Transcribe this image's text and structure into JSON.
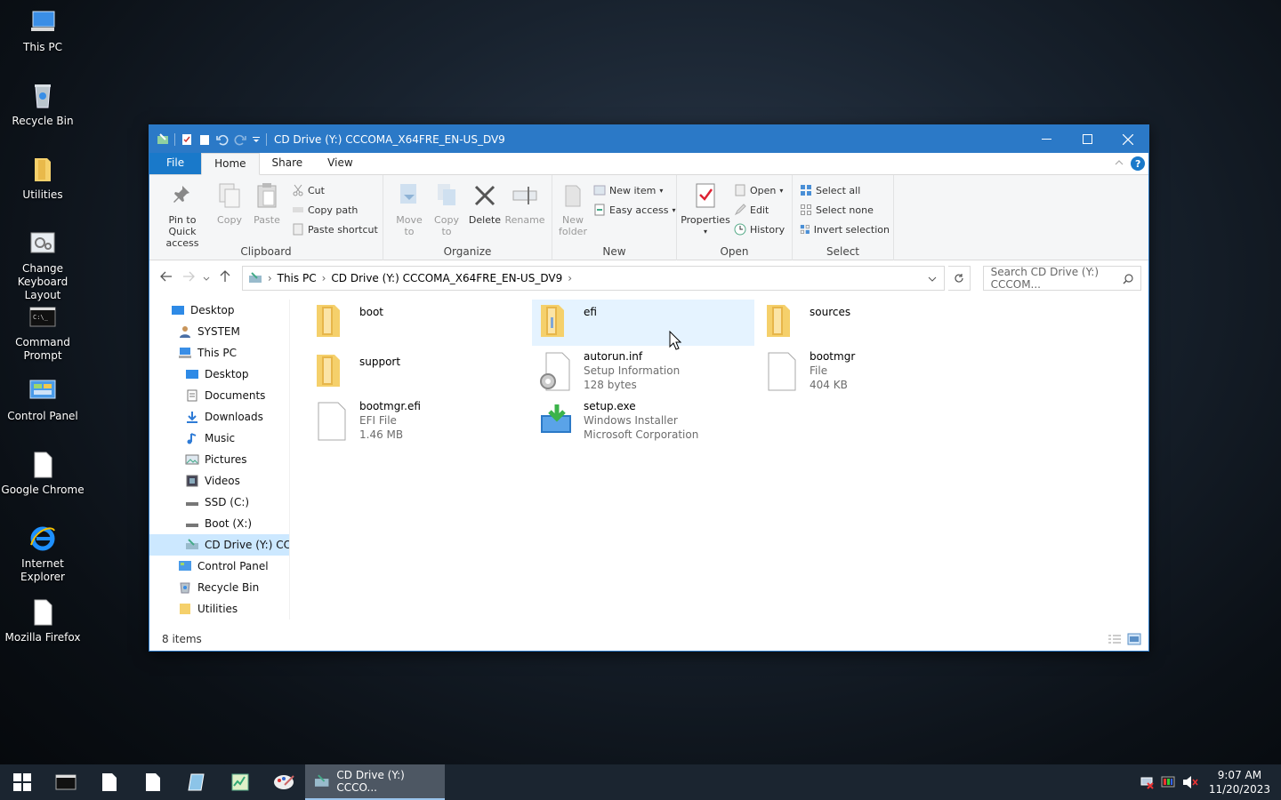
{
  "desktop": {
    "icons": [
      {
        "label": "This PC",
        "icon": "computer-icon"
      },
      {
        "label": "Recycle Bin",
        "icon": "recycle-bin-icon"
      },
      {
        "label": "Utilities",
        "icon": "folder-icon"
      },
      {
        "label": "Change Keyboard Layout",
        "icon": "settings-icon"
      },
      {
        "label": "Command Prompt",
        "icon": "cmd-icon"
      },
      {
        "label": "Control Panel",
        "icon": "control-panel-icon"
      },
      {
        "label": "Google Chrome",
        "icon": "file-icon"
      },
      {
        "label": "Internet Explorer",
        "icon": "ie-icon"
      },
      {
        "label": "Mozilla Firefox",
        "icon": "file-icon"
      }
    ]
  },
  "window": {
    "title": "CD Drive (Y:) CCCOMA_X64FRE_EN-US_DV9"
  },
  "ribbon": {
    "tabs": {
      "file": "File",
      "home": "Home",
      "share": "Share",
      "view": "View"
    },
    "clipboard": {
      "pin": "Pin to Quick access",
      "copy": "Copy",
      "paste": "Paste",
      "cut": "Cut",
      "copy_path": "Copy path",
      "paste_shortcut": "Paste shortcut",
      "label": "Clipboard"
    },
    "organize": {
      "move_to": "Move to",
      "copy_to": "Copy to",
      "delete": "Delete",
      "rename": "Rename",
      "label": "Organize"
    },
    "new": {
      "new_folder": "New folder",
      "new_item": "New item",
      "easy_access": "Easy access",
      "label": "New"
    },
    "open": {
      "properties": "Properties",
      "open": "Open",
      "edit": "Edit",
      "history": "History",
      "label": "Open"
    },
    "select": {
      "select_all": "Select all",
      "select_none": "Select none",
      "invert": "Invert selection",
      "label": "Select"
    }
  },
  "address": {
    "crumbs": [
      "This PC",
      "CD Drive (Y:) CCCOMA_X64FRE_EN-US_DV9"
    ],
    "search_placeholder": "Search CD Drive (Y:) CCCOM..."
  },
  "nav": {
    "items": [
      {
        "label": "Desktop"
      },
      {
        "label": "SYSTEM"
      },
      {
        "label": "This PC"
      },
      {
        "label": "Desktop"
      },
      {
        "label": "Documents"
      },
      {
        "label": "Downloads"
      },
      {
        "label": "Music"
      },
      {
        "label": "Pictures"
      },
      {
        "label": "Videos"
      },
      {
        "label": "SSD (C:)"
      },
      {
        "label": "Boot (X:)"
      },
      {
        "label": "CD Drive (Y:) CCC"
      },
      {
        "label": "Control Panel"
      },
      {
        "label": "Recycle Bin"
      },
      {
        "label": "Utilities"
      }
    ]
  },
  "files": [
    {
      "name": "boot",
      "line2": "",
      "line3": "",
      "type": "folder"
    },
    {
      "name": "efi",
      "line2": "",
      "line3": "",
      "type": "folder"
    },
    {
      "name": "sources",
      "line2": "",
      "line3": "",
      "type": "folder"
    },
    {
      "name": "support",
      "line2": "",
      "line3": "",
      "type": "folder"
    },
    {
      "name": "autorun.inf",
      "line2": "Setup Information",
      "line3": "128 bytes",
      "type": "inf"
    },
    {
      "name": "bootmgr",
      "line2": "File",
      "line3": "404 KB",
      "type": "file"
    },
    {
      "name": "bootmgr.efi",
      "line2": "EFI File",
      "line3": "1.46 MB",
      "type": "file"
    },
    {
      "name": "setup.exe",
      "line2": "Windows Installer",
      "line3": "Microsoft Corporation",
      "type": "setup"
    }
  ],
  "status": {
    "count": "8 items"
  },
  "taskbar": {
    "window_label": "CD Drive (Y:) CCCO...",
    "time": "9:07 AM",
    "date": "11/20/2023"
  },
  "colors": {
    "accent": "#2b79c7",
    "selection": "#cce8ff",
    "hover": "#e5f3ff",
    "folder": "#f5d06b"
  }
}
